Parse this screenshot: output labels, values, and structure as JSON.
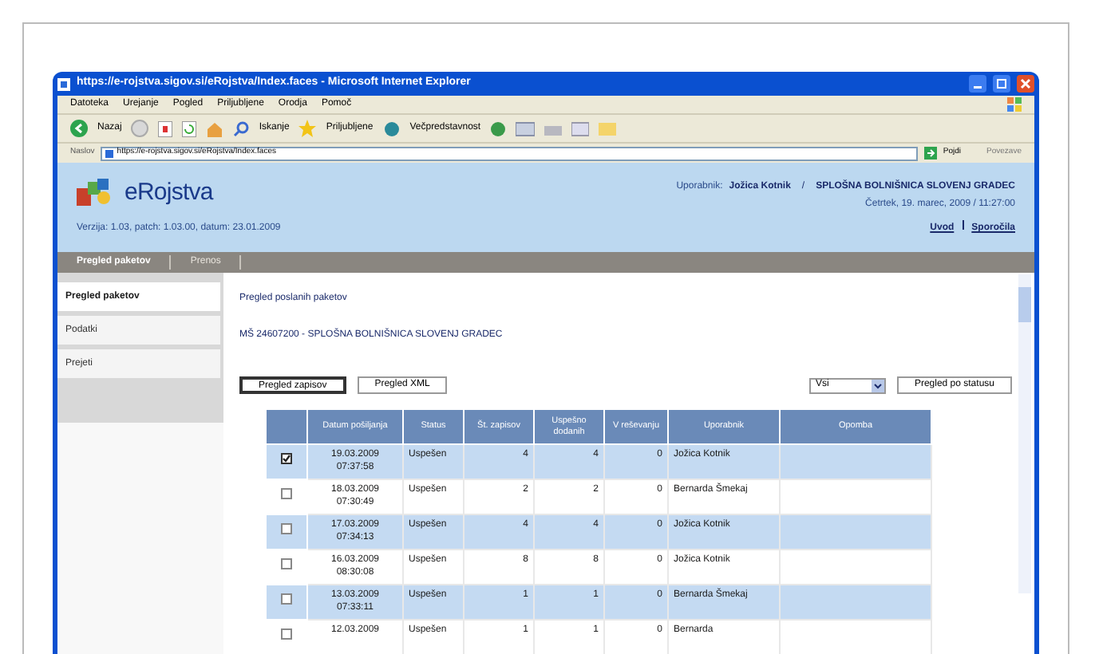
{
  "window": {
    "title": "https://e-rojstva.sigov.si/eRojstva/Index.faces - Microsoft Internet Explorer"
  },
  "menu": [
    "Datoteka",
    "Urejanje",
    "Pogled",
    "Priljubljene",
    "Orodja",
    "Pomoč"
  ],
  "toolbar": {
    "back": "Nazaj",
    "search": "Iskanje",
    "favorites": "Priljubljene",
    "media": "Večpredstavnost"
  },
  "address": {
    "label": "Naslov",
    "value": "https://e-rojstva.sigov.si/eRojstva/Index.faces",
    "go": "Pojdi",
    "links": "Povezave"
  },
  "app": {
    "logo": "eRojstva",
    "version": "Verzija: 1.03, patch: 1.03.00, datum: 23.01.2009",
    "user_label": "Uporabnik:",
    "user": "Jožica Kotnik",
    "separator": "/",
    "institution": "SPLOŠNA BOLNIŠNICA SLOVENJ GRADEC",
    "date": "Četrtek, 19. marec, 2009 / 11:27:00",
    "links": [
      "Uvod",
      "Sporočila"
    ]
  },
  "nav": [
    {
      "label": "Pregled paketov",
      "selected": true
    },
    {
      "label": "Prenos",
      "selected": false
    }
  ],
  "sidebar": [
    {
      "label": "Pregled paketov",
      "selected": true
    },
    {
      "label": "Podatki",
      "selected": false
    },
    {
      "label": "Prejeti",
      "selected": false
    }
  ],
  "content": {
    "heading": "Pregled poslanih paketov",
    "subheading": "MŠ 24607200 - SPLOŠNA BOLNIŠNICA SLOVENJ GRADEC",
    "buttons": [
      "Pregled zapisov",
      "Pregled XML"
    ],
    "filter": "Vsi",
    "filter_button": "Pregled po statusu"
  },
  "table": {
    "columns": [
      "Datum pošiljanja",
      "Status",
      "Št. zapisov",
      "Uspešno dodanih",
      "V reševanju",
      "Uporabnik",
      "Opomba"
    ],
    "rows": [
      {
        "checked": true,
        "date": "19.03.2009",
        "time": "07:37:58",
        "status": "Uspešen",
        "records": "4",
        "added": "4",
        "pending": "0",
        "user": "Jožica Kotnik"
      },
      {
        "checked": false,
        "date": "18.03.2009",
        "time": "07:30:49",
        "status": "Uspešen",
        "records": "2",
        "added": "2",
        "pending": "0",
        "user": "Bernarda Šmekaj"
      },
      {
        "checked": false,
        "date": "17.03.2009",
        "time": "07:34:13",
        "status": "Uspešen",
        "records": "4",
        "added": "4",
        "pending": "0",
        "user": "Jožica Kotnik"
      },
      {
        "checked": false,
        "date": "16.03.2009",
        "time": "08:30:08",
        "status": "Uspešen",
        "records": "8",
        "added": "8",
        "pending": "0",
        "user": "Jožica Kotnik"
      },
      {
        "checked": false,
        "date": "13.03.2009",
        "time": "07:33:11",
        "status": "Uspešen",
        "records": "1",
        "added": "1",
        "pending": "0",
        "user": "Bernarda Šmekaj"
      },
      {
        "checked": false,
        "date": "12.03.2009",
        "status": "Uspešen",
        "records": "1",
        "added": "1",
        "pending": "0",
        "user": "Bernarda"
      }
    ]
  }
}
